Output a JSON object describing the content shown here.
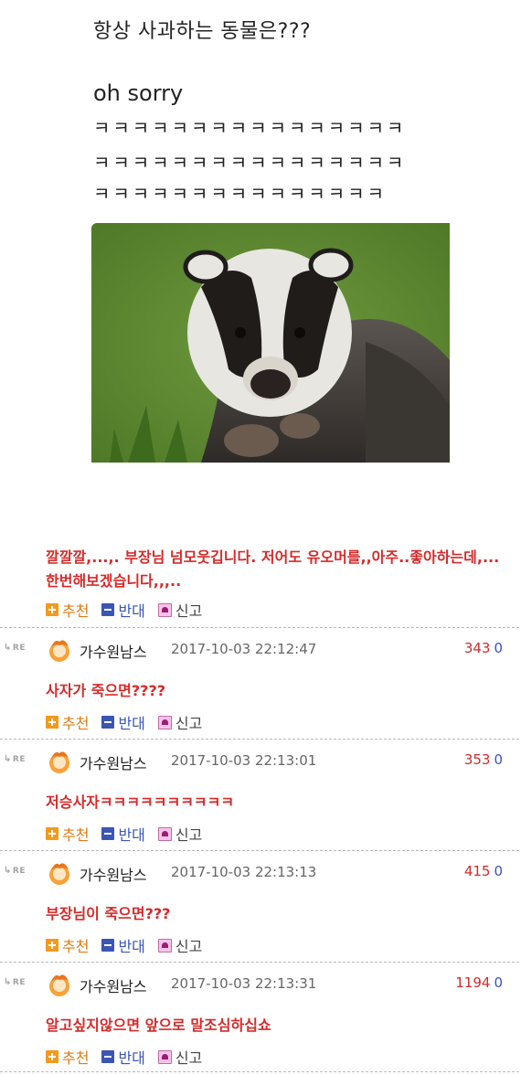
{
  "post": {
    "question": "항상 사과하는 동물은???",
    "answer": "oh sorry",
    "laugh_lines": [
      "ㅋㅋㅋㅋㅋㅋㅋㅋㅋㅋㅋㅋㅋㅋㅋㅋ",
      "ㅋㅋㅋㅋㅋㅋㅋㅋㅋㅋㅋㅋㅋㅋㅋㅋ",
      "ㅋㅋㅋㅋㅋㅋㅋㅋㅋㅋㅋㅋㅋㅋㅋ"
    ],
    "image": "badger-photo"
  },
  "top_comment": {
    "text": "깔깔깔,...,. 부장님 넘모웃깁니다. 저어도 유오머를,,아주..좋아하는데,... 한번해보겠습니다,,,..",
    "actions": {
      "recommend": "추천",
      "oppose": "반대",
      "report": "신고"
    }
  },
  "replies": [
    {
      "re": "RE",
      "nick": "가수원남스",
      "date": "2017-10-03 22:12:47",
      "up": "343",
      "down": "0",
      "text": "사자가 죽으면????",
      "actions": {
        "recommend": "추천",
        "oppose": "반대",
        "report": "신고"
      }
    },
    {
      "re": "RE",
      "nick": "가수원남스",
      "date": "2017-10-03 22:13:01",
      "up": "353",
      "down": "0",
      "text": "저승사자ㅋㅋㅋㅋㅋㅋㅋㅋㅋㅋ",
      "actions": {
        "recommend": "추천",
        "oppose": "반대",
        "report": "신고"
      }
    },
    {
      "re": "RE",
      "nick": "가수원남스",
      "date": "2017-10-03 22:13:13",
      "up": "415",
      "down": "0",
      "text": "부장님이 죽으면???",
      "actions": {
        "recommend": "추천",
        "oppose": "반대",
        "report": "신고"
      }
    },
    {
      "re": "RE",
      "nick": "가수원남스",
      "date": "2017-10-03 22:13:31",
      "up": "1194",
      "down": "0",
      "text": "알고싶지않으면 앞으로 말조심하십쇼",
      "actions": {
        "recommend": "추천",
        "oppose": "반대",
        "report": "신고"
      }
    }
  ],
  "colors": {
    "accent_red": "#d62a2a",
    "recommend_orange": "#f39a1e",
    "oppose_blue": "#3b55b4"
  }
}
